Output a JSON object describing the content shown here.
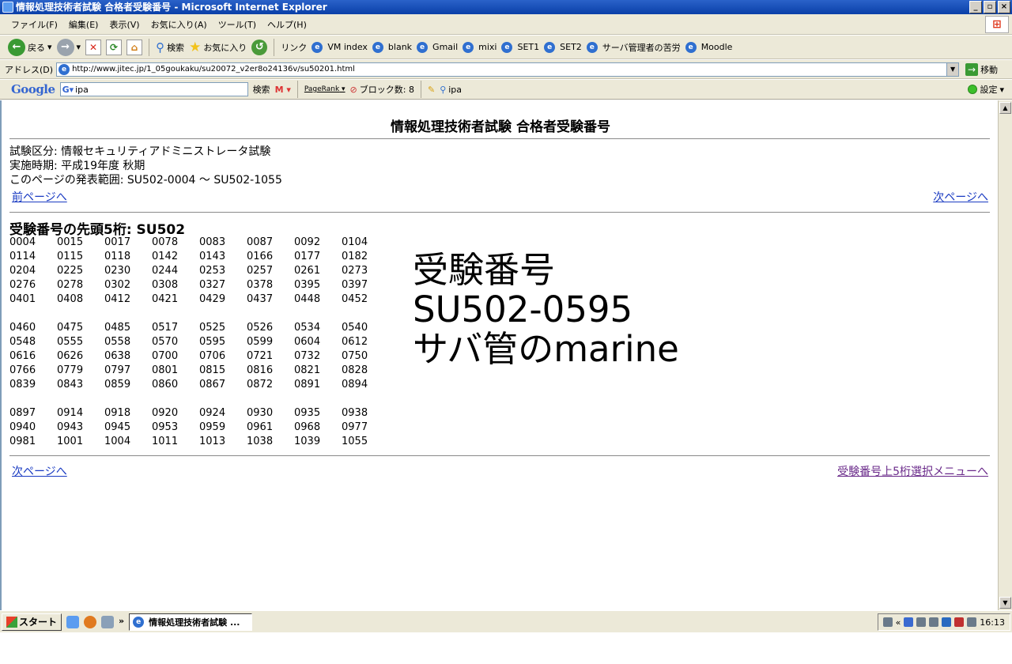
{
  "window": {
    "title": "情報処理技術者試験 合格者受験番号 - Microsoft Internet Explorer",
    "minimize": "_",
    "restore": "▫",
    "close": "×"
  },
  "menu": {
    "items": [
      "ファイル(F)",
      "編集(E)",
      "表示(V)",
      "お気に入り(A)",
      "ツール(T)",
      "ヘルプ(H)"
    ]
  },
  "toolbar": {
    "back": "戻る",
    "search": "検索",
    "favorites": "お気に入り",
    "links_label": "リンク",
    "links": [
      "VM index",
      "blank",
      "Gmail",
      "mixi",
      "SET1",
      "SET2",
      "サーバ管理者の苦労",
      "Moodle"
    ]
  },
  "address": {
    "label": "アドレス(D)",
    "url": "http://www.jitec.jp/1_05goukaku/su20072_v2er8o24136v/su50201.html",
    "go": "移動"
  },
  "google": {
    "logo": "Google",
    "query": "ipa",
    "search_btn": "検索",
    "pagerank": "PageRank",
    "blocked": "ブロック数: 8",
    "highlight": "ipa",
    "settings": "設定"
  },
  "page": {
    "title": "情報処理技術者試験 合格者受験番号",
    "exam_category": "試験区分: 情報セキュリティアドミニストレータ試験",
    "exam_period": "実施時期: 平成19年度  秋期",
    "range": "このページの発表範囲: SU502-0004 ～ SU502-1055",
    "prev_link": "前ページへ",
    "next_link_top": "次ページへ",
    "prefix_label": "受験番号の先頭5桁: SU502",
    "next_link_bottom": "次ページへ",
    "menu_link": "受験番号上5桁選択メニューへ",
    "numbers_block1": [
      "0004",
      "0015",
      "0017",
      "0078",
      "0083",
      "0087",
      "0092",
      "0104",
      "0114",
      "0115",
      "0118",
      "0142",
      "0143",
      "0166",
      "0177",
      "0182",
      "0204",
      "0225",
      "0230",
      "0244",
      "0253",
      "0257",
      "0261",
      "0273",
      "0276",
      "0278",
      "0302",
      "0308",
      "0327",
      "0378",
      "0395",
      "0397",
      "0401",
      "0408",
      "0412",
      "0421",
      "0429",
      "0437",
      "0448",
      "0452"
    ],
    "numbers_block2": [
      "0460",
      "0475",
      "0485",
      "0517",
      "0525",
      "0526",
      "0534",
      "0540",
      "0548",
      "0555",
      "0558",
      "0570",
      "0595",
      "0599",
      "0604",
      "0612",
      "0616",
      "0626",
      "0638",
      "0700",
      "0706",
      "0721",
      "0732",
      "0750",
      "0766",
      "0779",
      "0797",
      "0801",
      "0815",
      "0816",
      "0821",
      "0828",
      "0839",
      "0843",
      "0859",
      "0860",
      "0867",
      "0872",
      "0891",
      "0894"
    ],
    "numbers_block3": [
      "0897",
      "0914",
      "0918",
      "0920",
      "0924",
      "0930",
      "0935",
      "0938",
      "0940",
      "0943",
      "0945",
      "0953",
      "0959",
      "0961",
      "0968",
      "0977",
      "0981",
      "1001",
      "1004",
      "1011",
      "1013",
      "1038",
      "1039",
      "1055"
    ],
    "overlay_lines": [
      "受験番号",
      "SU502-0595",
      "サバ管のmarine"
    ]
  },
  "taskbar": {
    "start": "スタート",
    "chevron": "»",
    "task": "情報処理技術者試験 ...",
    "tray_chevron": "«",
    "clock": "16:13"
  }
}
